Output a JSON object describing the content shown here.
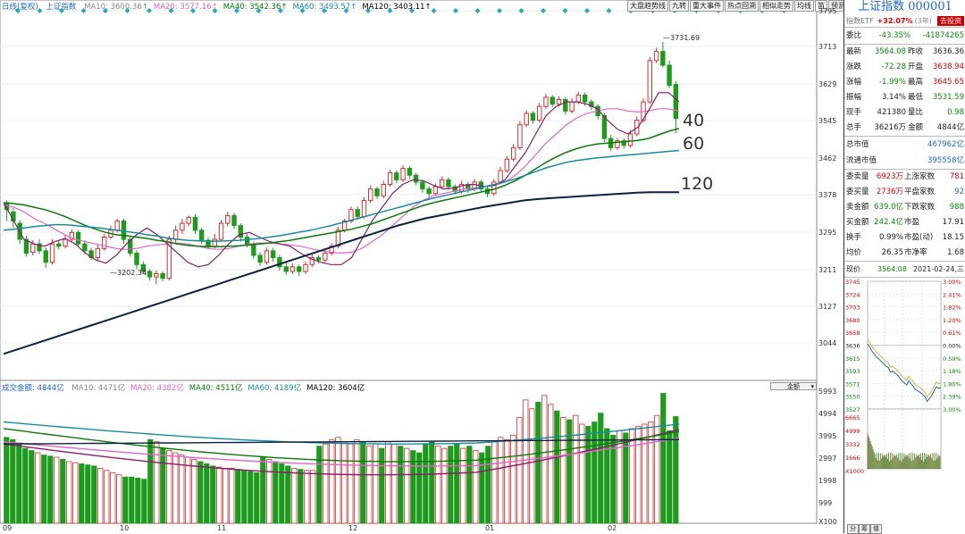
{
  "kline_legend": {
    "label": "日线(复权)",
    "name": "上证指数",
    "ma": [
      {
        "t": "MA10: 3600.36↑",
        "c": "#888888"
      },
      {
        "t": "MA20: 3577.16↑",
        "c": "#e065c8"
      },
      {
        "t": "MA40: 3542.36↑",
        "c": "#0a7a0a"
      },
      {
        "t": "MA60: 3493.57↑",
        "c": "#1a8aa0"
      },
      {
        "t": "MA120: 3403.11↑",
        "c": "#000000"
      }
    ]
  },
  "vol_legend": {
    "label": "成交金额: 4844亿",
    "ma": [
      {
        "t": "MA10: 4471亿",
        "c": "#888888"
      },
      {
        "t": "MA20: 4382亿",
        "c": "#e065c8"
      },
      {
        "t": "MA40: 4511亿",
        "c": "#0a7a0a"
      },
      {
        "t": "MA60: 4189亿",
        "c": "#1a8aa0"
      },
      {
        "t": "MA120: 3604亿",
        "c": "#000000"
      }
    ],
    "btn": "金额"
  },
  "toolbar": [
    "大盘趋势线",
    "九转",
    "重大事件",
    "热点回溯",
    "相似走势",
    "均线",
    "笛",
    "预测"
  ],
  "price_axis": [
    "3795",
    "3713",
    "3629",
    "3545",
    "3462",
    "3378",
    "3295",
    "3211",
    "3127",
    "3044"
  ],
  "vol_axis": [
    "5993",
    "4994",
    "3995",
    "2997",
    "1998",
    "999",
    "X100"
  ],
  "ma_big_labels": [
    "40",
    "60",
    "120"
  ],
  "high_label": "3731.69",
  "low_label": "3202.34",
  "x_labels": [
    "09",
    "10",
    "11",
    "12",
    "01",
    "02"
  ],
  "right": {
    "title": "上证指数 000001",
    "etf": "指数ETF",
    "etf_pct": "+32.07%",
    "etf_yr": "(3年)",
    "etf_btn": "去投资",
    "wei": [
      {
        "l": "委比",
        "v": "-43.35%",
        "v2": "-41874265"
      }
    ],
    "q": [
      {
        "l": "最新",
        "v": "3564.08",
        "l2": "昨收",
        "v2": "3636.36",
        "vc": "green",
        "v2c": ""
      },
      {
        "l": "涨跌",
        "v": "-72.28",
        "l2": "开盘",
        "v2": "3638.94",
        "vc": "green",
        "v2c": "red"
      },
      {
        "l": "涨幅",
        "v": "-1.99%",
        "l2": "最高",
        "v2": "3645.65",
        "vc": "green",
        "v2c": "red"
      },
      {
        "l": "振幅",
        "v": "3.14%",
        "l2": "最低",
        "v2": "3531.59",
        "vc": "",
        "v2c": "green"
      },
      {
        "l": "现手",
        "v": "421380",
        "l2": "量比",
        "v2": "0.98",
        "vc": "",
        "v2c": "green"
      },
      {
        "l": "总手",
        "v": "36216万",
        "l2": "金额",
        "v2": "4844亿",
        "vc": "",
        "v2c": ""
      }
    ],
    "cap": [
      {
        "l": "总市值",
        "v": "467962亿"
      },
      {
        "l": "流通市值",
        "v": "395558亿"
      }
    ],
    "stats": [
      {
        "l": "委卖量",
        "v": "6923万",
        "l2": "上涨家数",
        "v2": "781",
        "vc": "red",
        "v2c": "red"
      },
      {
        "l": "委买量",
        "v": "2736万",
        "l2": "平盘家数",
        "v2": "92",
        "vc": "red",
        "v2c": "blue"
      },
      {
        "l": "卖金额",
        "v": "639.0亿",
        "l2": "下跌家数",
        "v2": "988",
        "vc": "green",
        "v2c": "green"
      },
      {
        "l": "买金额",
        "v": "242.4亿",
        "l2": "市盈",
        "v2": "17.91",
        "vc": "green",
        "v2c": ""
      },
      {
        "l": "换手",
        "v": "0.99%",
        "l2": "市盈(动)",
        "v2": "18.15",
        "vc": "",
        "v2c": ""
      },
      {
        "l": "均价",
        "v": "26.35",
        "l2": "市净率",
        "v2": "1.68",
        "vc": "",
        "v2c": ""
      }
    ],
    "now": {
      "l": "现价",
      "v": "3564.08",
      "date": "2021-02-24,三"
    },
    "mini_left": [
      "3745",
      "3724",
      "3703",
      "3680",
      "3658",
      "3636",
      "3615",
      "3593",
      "3571",
      "3550",
      "3527"
    ],
    "mini_right": [
      "3.00%",
      "2.41%",
      "1.82%",
      "1.20%",
      "0.61%",
      "0.00%",
      "0.59%",
      "1.18%",
      "1.80%",
      "2.39%",
      "3.00%"
    ],
    "mini_vol": [
      "6665",
      "4999",
      "3332",
      "1666",
      "X1000"
    ]
  },
  "tabs": [
    "分",
    "筹",
    "值"
  ],
  "chart_data": {
    "type": "candlestick",
    "ylim": [
      3000,
      3795
    ],
    "note_units": "index points; volume in 亿",
    "candles": [
      [
        3380,
        3365,
        3385,
        3340
      ],
      [
        3360,
        3340,
        3368,
        3325
      ],
      [
        3335,
        3300,
        3342,
        3290
      ],
      [
        3300,
        3270,
        3308,
        3262
      ],
      [
        3272,
        3290,
        3298,
        3265
      ],
      [
        3290,
        3275,
        3300,
        3268
      ],
      [
        3275,
        3250,
        3282,
        3238
      ],
      [
        3250,
        3290,
        3300,
        3245
      ],
      [
        3290,
        3285,
        3298,
        3278
      ],
      [
        3285,
        3300,
        3310,
        3280
      ],
      [
        3300,
        3315,
        3322,
        3295
      ],
      [
        3315,
        3290,
        3320,
        3285
      ],
      [
        3290,
        3275,
        3298,
        3268
      ],
      [
        3275,
        3260,
        3282,
        3255
      ],
      [
        3260,
        3280,
        3290,
        3252
      ],
      [
        3280,
        3305,
        3312,
        3275
      ],
      [
        3305,
        3320,
        3330,
        3300
      ],
      [
        3320,
        3340,
        3345,
        3315
      ],
      [
        3340,
        3300,
        3345,
        3290
      ],
      [
        3300,
        3270,
        3305,
        3262
      ],
      [
        3270,
        3245,
        3276,
        3235
      ],
      [
        3245,
        3230,
        3252,
        3225
      ],
      [
        3230,
        3218,
        3235,
        3210
      ],
      [
        3218,
        3225,
        3232,
        3202
      ],
      [
        3225,
        3215,
        3230,
        3208
      ],
      [
        3215,
        3300,
        3308,
        3210
      ],
      [
        3300,
        3320,
        3330,
        3292
      ],
      [
        3320,
        3335,
        3345,
        3312
      ],
      [
        3335,
        3348,
        3352,
        3328
      ],
      [
        3348,
        3320,
        3355,
        3312
      ],
      [
        3320,
        3298,
        3325,
        3290
      ],
      [
        3298,
        3285,
        3305,
        3278
      ],
      [
        3285,
        3300,
        3312,
        3280
      ],
      [
        3300,
        3335,
        3342,
        3295
      ],
      [
        3335,
        3352,
        3360,
        3328
      ],
      [
        3352,
        3330,
        3358,
        3322
      ],
      [
        3330,
        3305,
        3335,
        3295
      ],
      [
        3305,
        3290,
        3312,
        3282
      ],
      [
        3290,
        3265,
        3295,
        3258
      ],
      [
        3265,
        3250,
        3272,
        3242
      ],
      [
        3250,
        3275,
        3282,
        3245
      ],
      [
        3275,
        3260,
        3282,
        3252
      ],
      [
        3260,
        3240,
        3266,
        3232
      ],
      [
        3240,
        3230,
        3250,
        3222
      ],
      [
        3230,
        3240,
        3248,
        3225
      ],
      [
        3240,
        3230,
        3245,
        3220
      ],
      [
        3230,
        3245,
        3252,
        3225
      ],
      [
        3245,
        3260,
        3268,
        3240
      ],
      [
        3260,
        3255,
        3265,
        3248
      ],
      [
        3255,
        3270,
        3278,
        3250
      ],
      [
        3270,
        3285,
        3292,
        3265
      ],
      [
        3285,
        3320,
        3328,
        3280
      ],
      [
        3320,
        3340,
        3345,
        3315
      ],
      [
        3340,
        3365,
        3372,
        3335
      ],
      [
        3365,
        3350,
        3372,
        3342
      ],
      [
        3350,
        3385,
        3392,
        3345
      ],
      [
        3385,
        3410,
        3418,
        3380
      ],
      [
        3410,
        3395,
        3415,
        3388
      ],
      [
        3395,
        3420,
        3428,
        3390
      ],
      [
        3420,
        3445,
        3452,
        3415
      ],
      [
        3445,
        3430,
        3450,
        3422
      ],
      [
        3430,
        3455,
        3462,
        3425
      ],
      [
        3455,
        3440,
        3460,
        3432
      ],
      [
        3440,
        3425,
        3445,
        3418
      ],
      [
        3425,
        3410,
        3430,
        3402
      ],
      [
        3410,
        3400,
        3415,
        3392
      ],
      [
        3400,
        3415,
        3422,
        3395
      ],
      [
        3415,
        3430,
        3438,
        3410
      ],
      [
        3430,
        3415,
        3435,
        3408
      ],
      [
        3415,
        3405,
        3420,
        3398
      ],
      [
        3405,
        3420,
        3428,
        3400
      ],
      [
        3420,
        3410,
        3425,
        3402
      ],
      [
        3410,
        3425,
        3432,
        3405
      ],
      [
        3425,
        3410,
        3430,
        3402
      ],
      [
        3410,
        3400,
        3415,
        3392
      ],
      [
        3400,
        3425,
        3432,
        3395
      ],
      [
        3425,
        3450,
        3458,
        3420
      ],
      [
        3450,
        3475,
        3482,
        3445
      ],
      [
        3475,
        3500,
        3508,
        3470
      ],
      [
        3500,
        3550,
        3558,
        3495
      ],
      [
        3550,
        3575,
        3582,
        3545
      ],
      [
        3575,
        3560,
        3580,
        3552
      ],
      [
        3560,
        3590,
        3598,
        3555
      ],
      [
        3590,
        3610,
        3618,
        3585
      ],
      [
        3610,
        3595,
        3615,
        3588
      ],
      [
        3595,
        3605,
        3612,
        3590
      ],
      [
        3605,
        3580,
        3610,
        3572
      ],
      [
        3580,
        3600,
        3608,
        3575
      ],
      [
        3600,
        3615,
        3622,
        3595
      ],
      [
        3615,
        3600,
        3620,
        3592
      ],
      [
        3600,
        3590,
        3605,
        3582
      ],
      [
        3590,
        3570,
        3595,
        3562
      ],
      [
        3570,
        3520,
        3575,
        3512
      ],
      [
        3520,
        3500,
        3528,
        3492
      ],
      [
        3500,
        3515,
        3522,
        3495
      ],
      [
        3515,
        3505,
        3520,
        3498
      ],
      [
        3505,
        3530,
        3538,
        3500
      ],
      [
        3530,
        3560,
        3568,
        3525
      ],
      [
        3560,
        3600,
        3608,
        3555
      ],
      [
        3600,
        3690,
        3698,
        3595
      ],
      [
        3690,
        3710,
        3718,
        3685
      ],
      [
        3710,
        3680,
        3731,
        3675
      ],
      [
        3680,
        3636,
        3690,
        3630
      ],
      [
        3638,
        3564,
        3645,
        3531
      ]
    ],
    "ma10": [
      3380,
      3340,
      3300,
      3290,
      3285,
      3295,
      3302,
      3290,
      3270,
      3255,
      3248,
      3265,
      3290,
      3310,
      3325,
      3310,
      3290,
      3270,
      3250,
      3240,
      3245,
      3265,
      3290,
      3310,
      3315,
      3305,
      3295,
      3290,
      3285,
      3270,
      3258,
      3250,
      3245,
      3245,
      3260,
      3300,
      3340,
      3370,
      3400,
      3420,
      3430,
      3428,
      3418,
      3410,
      3412,
      3418,
      3420,
      3415,
      3418,
      3430,
      3460,
      3490,
      3530,
      3570,
      3590,
      3600,
      3600,
      3595,
      3585,
      3560,
      3540,
      3530,
      3545,
      3580,
      3620,
      3620,
      3600
    ],
    "ma20": [
      3375,
      3370,
      3360,
      3345,
      3335,
      3322,
      3310,
      3300,
      3295,
      3290,
      3285,
      3280,
      3278,
      3280,
      3285,
      3288,
      3290,
      3292,
      3290,
      3285,
      3280,
      3278,
      3280,
      3285,
      3290,
      3292,
      3292,
      3290,
      3288,
      3285,
      3280,
      3275,
      3272,
      3270,
      3272,
      3280,
      3295,
      3310,
      3330,
      3350,
      3370,
      3385,
      3395,
      3400,
      3405,
      3410,
      3412,
      3415,
      3418,
      3425,
      3440,
      3460,
      3485,
      3510,
      3530,
      3550,
      3565,
      3575,
      3580,
      3585,
      3585,
      3580,
      3578,
      3580,
      3585,
      3585,
      3580
    ],
    "ma40": [
      3380,
      3378,
      3375,
      3370,
      3365,
      3358,
      3350,
      3340,
      3330,
      3322,
      3315,
      3310,
      3308,
      3305,
      3302,
      3298,
      3295,
      3290,
      3287,
      3285,
      3284,
      3284,
      3285,
      3286,
      3288,
      3290,
      3292,
      3295,
      3298,
      3302,
      3306,
      3310,
      3314,
      3318,
      3322,
      3328,
      3334,
      3342,
      3350,
      3358,
      3366,
      3374,
      3380,
      3385,
      3390,
      3395,
      3400,
      3405,
      3410,
      3418,
      3428,
      3440,
      3454,
      3468,
      3480,
      3490,
      3498,
      3504,
      3508,
      3510,
      3512,
      3514,
      3516,
      3520,
      3528,
      3536,
      3542
    ],
    "ma60": [
      3320,
      3322,
      3325,
      3328,
      3330,
      3332,
      3332,
      3330,
      3328,
      3326,
      3323,
      3320,
      3317,
      3314,
      3310,
      3307,
      3303,
      3300,
      3298,
      3297,
      3296,
      3296,
      3297,
      3298,
      3300,
      3302,
      3305,
      3308,
      3312,
      3316,
      3320,
      3325,
      3330,
      3336,
      3342,
      3348,
      3354,
      3360,
      3366,
      3372,
      3378,
      3384,
      3390,
      3395,
      3400,
      3405,
      3410,
      3415,
      3420,
      3426,
      3432,
      3440,
      3448,
      3456,
      3462,
      3468,
      3472,
      3475,
      3478,
      3480,
      3482,
      3484,
      3486,
      3488,
      3490,
      3492,
      3494
    ],
    "ma120": [
      3050,
      3060,
      3070,
      3080,
      3090,
      3100,
      3110,
      3120,
      3130,
      3140,
      3150,
      3160,
      3170,
      3180,
      3190,
      3200,
      3210,
      3220,
      3230,
      3240,
      3250,
      3260,
      3270,
      3280,
      3290,
      3300,
      3310,
      3320,
      3330,
      3338,
      3346,
      3352,
      3358,
      3364,
      3370,
      3375,
      3380,
      3385,
      3388,
      3390,
      3392,
      3394,
      3396,
      3398,
      3400,
      3402,
      3403,
      3403,
      3403
    ],
    "vol": [
      3900,
      3800,
      3650,
      3400,
      3300,
      3200,
      3100,
      3050,
      3000,
      2900,
      2800,
      2750,
      2700,
      2650,
      2600,
      2500,
      2400,
      2300,
      2200,
      2100,
      2100,
      2050,
      2000,
      3800,
      3700,
      3400,
      3300,
      3200,
      3100,
      3000,
      2900,
      2800,
      2700,
      2600,
      2550,
      2500,
      2500,
      2450,
      2400,
      2350,
      2300,
      3000,
      2900,
      2800,
      2700,
      2600,
      2500,
      2450,
      2400,
      2400,
      3500,
      3600,
      3800,
      3900,
      3700,
      3600,
      3800,
      3700,
      3500,
      3600,
      3400,
      3700,
      3600,
      3500,
      3400,
      3300,
      3200,
      3600,
      3700,
      3500,
      3400,
      3500,
      3600,
      3400,
      3500,
      3300,
      3200,
      3500,
      3700,
      3900,
      3800,
      4000,
      4800,
      5600,
      5200,
      5500,
      5800,
      5400,
      5100,
      4800,
      4700,
      4900,
      4500,
      4400,
      4600,
      5000,
      4300,
      4000,
      4200,
      4100,
      4300,
      4400,
      4500,
      4600,
      4900,
      5900,
      4200,
      4844
    ]
  }
}
